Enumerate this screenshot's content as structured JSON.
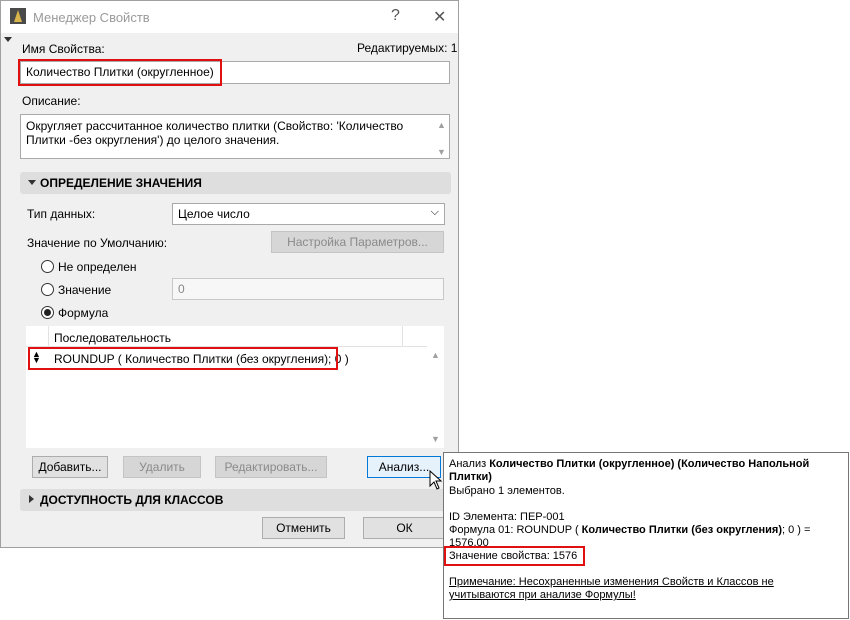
{
  "window": {
    "title": "Менеджер Свойств",
    "help_icon": "?",
    "close_icon": "✕"
  },
  "property": {
    "name_label": "Имя Свойства:",
    "editable_label": "Редактируемых: 1",
    "name_value": "Количество Плитки (округленное)",
    "description_label": "Описание:",
    "description_line1": "Округляет рассчитанное количество плитки (Свойство: 'Количество",
    "description_line2": "Плитки -без округления') до целого значения."
  },
  "value_definition": {
    "header": "ОПРЕДЕЛЕНИЕ ЗНАЧЕНИЯ",
    "data_type_label": "Тип данных:",
    "data_type_value": "Целое число",
    "default_value_label": "Значение по Умолчанию:",
    "settings_button": "Настройка Параметров...",
    "radio_undefined": "Не определен",
    "radio_value": "Значение",
    "value_input": "0",
    "radio_formula": "Формула",
    "selected_radio": "Формула",
    "sequence_header": "Последовательность",
    "formula": "ROUNDUP ( Количество Плитки (без округления); 0 )"
  },
  "buttons": {
    "add": "Добавить...",
    "delete": "Удалить",
    "edit": "Редактировать...",
    "analyze": "Анализ...",
    "cancel": "Отменить",
    "ok": "ОК"
  },
  "class_availability": {
    "header": "ДОСТУПНОСТЬ ДЛЯ КЛАССОВ"
  },
  "tooltip": {
    "line1_prefix": "Анализ ",
    "line1_bold": "Количество Плитки (округленное) (Количество Напольной",
    "line2_bold": "Плитки)",
    "line3": "Выбрано 1 элементов.",
    "element_id": "ID Элемента: ПЕР-001",
    "formula_prefix": "Формула 01: ROUNDUP ( ",
    "formula_bold": "Количество Плитки (без округления)",
    "formula_suffix": "; 0 ) =",
    "formula_result": "1576,00",
    "property_value": "Значение свойства: 1576",
    "note_line1": "Примечание: Несохраненные изменения Свойств и Классов не",
    "note_line2": "учитываются при анализе Формулы!"
  },
  "icons": {
    "app": "archicad-icon",
    "dropdown": "chevron-down-icon",
    "formula_row": "sort-arrows-icon",
    "cursor": "mouse-cursor-icon"
  }
}
